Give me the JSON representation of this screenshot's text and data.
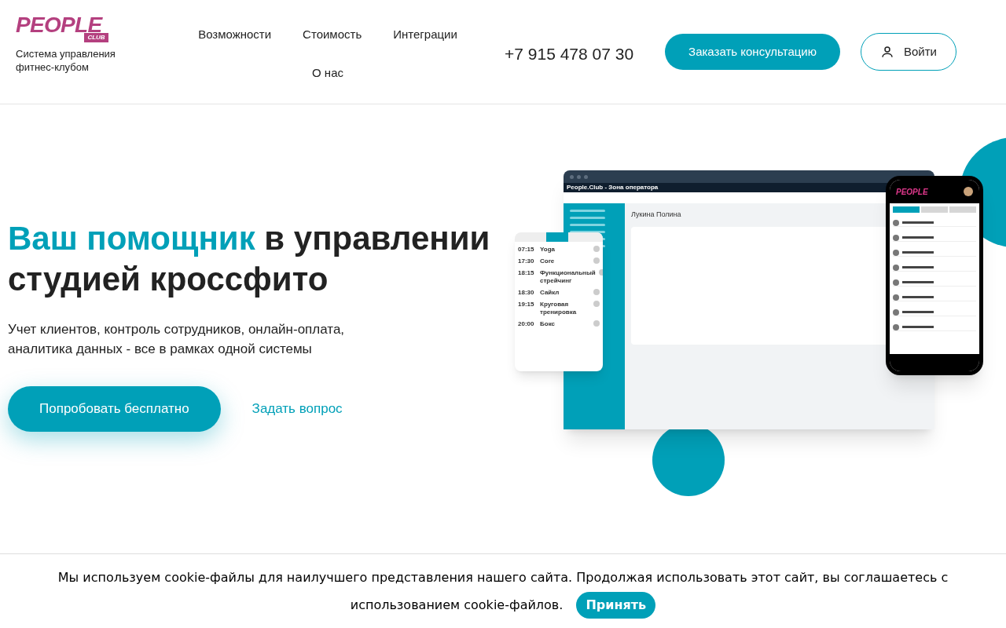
{
  "header": {
    "logo": {
      "word": "PEOPLE",
      "badge": "CLUB"
    },
    "tagline": "Система управления фитнес-клубом",
    "nav": [
      {
        "label": "Возможности"
      },
      {
        "label": "Стоимость"
      },
      {
        "label": "Интеграции"
      },
      {
        "label": "О нас"
      }
    ],
    "phone": "+7 915 478 07 30",
    "consult_button": "Заказать консультацию",
    "login_button": "Войти"
  },
  "hero": {
    "title_accent": "Ваш помощник",
    "title_rest": "в управлении",
    "title_line2": "студией кроссфито",
    "subtitle": "Учет клиентов, контроль сотрудников, онлайн-оплата, аналитика данных - все в рамках одной системы",
    "primary_button": "Попробовать бесплатно",
    "secondary_link": "Задать вопрос",
    "mockup": {
      "window_title": "People.Club - Зона оператора",
      "client_name": "Лукина Полина",
      "schedule": [
        {
          "time": "07:15",
          "title": "Yoga"
        },
        {
          "time": "17:30",
          "title": "Core"
        },
        {
          "time": "18:15",
          "title": "Функциональный стрейчинг"
        },
        {
          "time": "18:30",
          "title": "Сайкл"
        },
        {
          "time": "19:15",
          "title": "Круговая тренировка"
        },
        {
          "time": "20:00",
          "title": "Бокс"
        }
      ],
      "phone_logo": "PEOPLE",
      "phone_tabs": [
        {
          "selected": true
        },
        {
          "selected": false
        },
        {
          "selected": false
        }
      ]
    }
  },
  "cookie": {
    "text": "Мы используем cookie-файлы для наилучшего представления нашего сайта. Продолжая использовать этот сайт, вы соглашаетесь с использованием cookie-файлов.",
    "accept_button": "Принять"
  }
}
